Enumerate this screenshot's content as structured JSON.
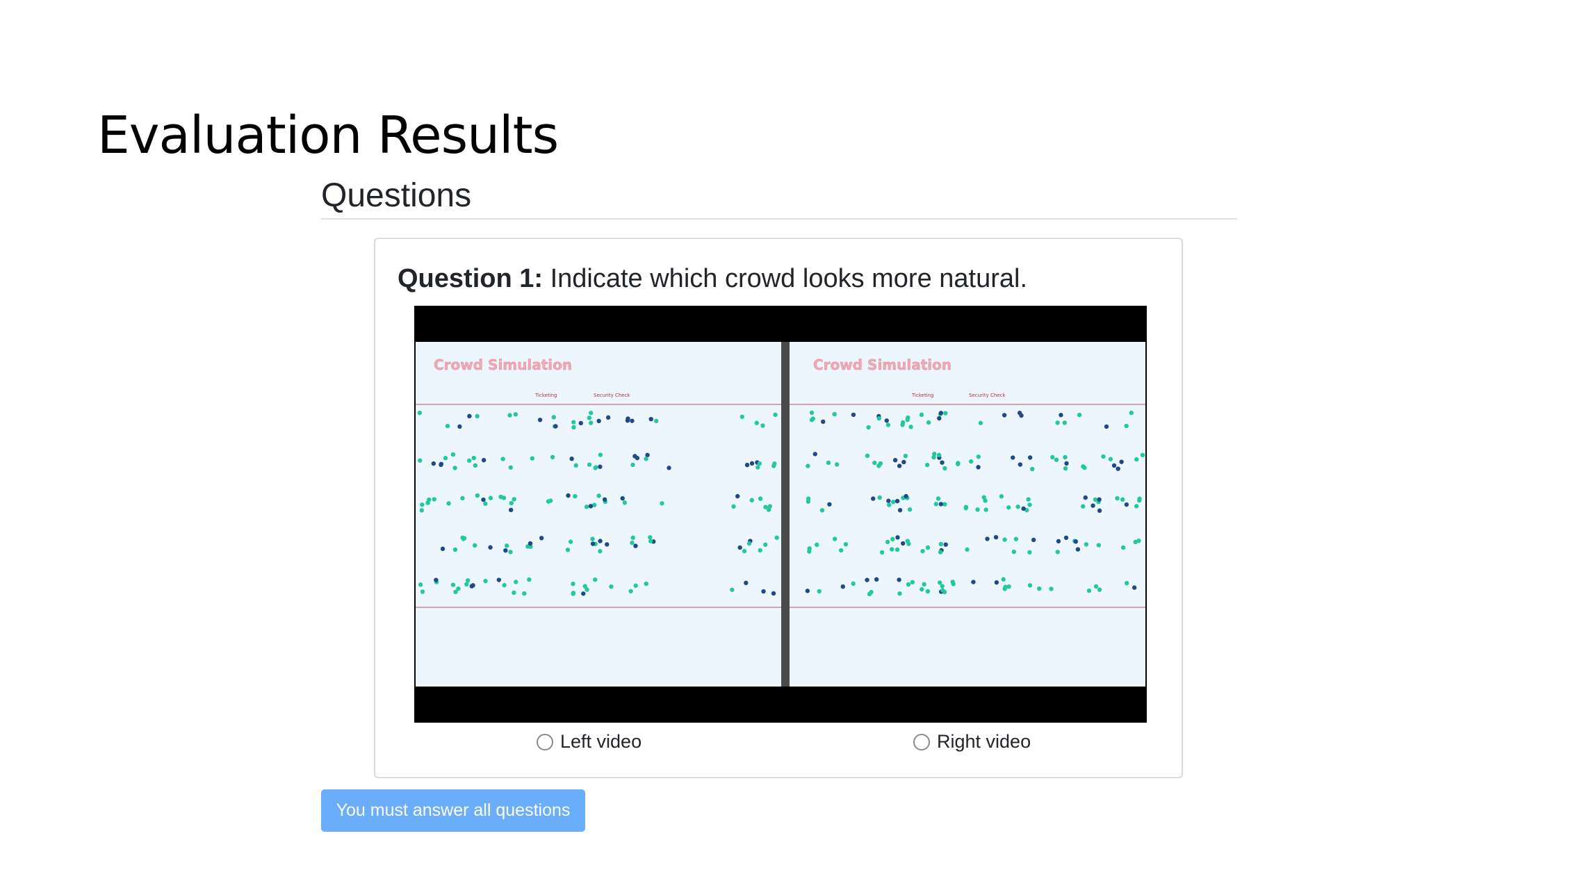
{
  "page": {
    "title": "Evaluation Results",
    "section_title": "Questions"
  },
  "question": {
    "number_label": "Question 1:",
    "text": "Indicate which crowd looks more natural.",
    "video": {
      "frame_title": "Crowd Simulation",
      "label_ticketing": "Ticketing",
      "label_security": "Security Check"
    },
    "options": [
      {
        "label": "Left video",
        "selected": false
      },
      {
        "label": "Right video",
        "selected": false
      }
    ]
  },
  "submit": {
    "label": "You must answer all questions",
    "enabled": false
  },
  "colors": {
    "agent_teal": "#22c9a0",
    "agent_navy": "#1f4a86",
    "lane_line": "#c98a94",
    "frame_title": "#f0a8b4",
    "button": "#6aaefb"
  }
}
